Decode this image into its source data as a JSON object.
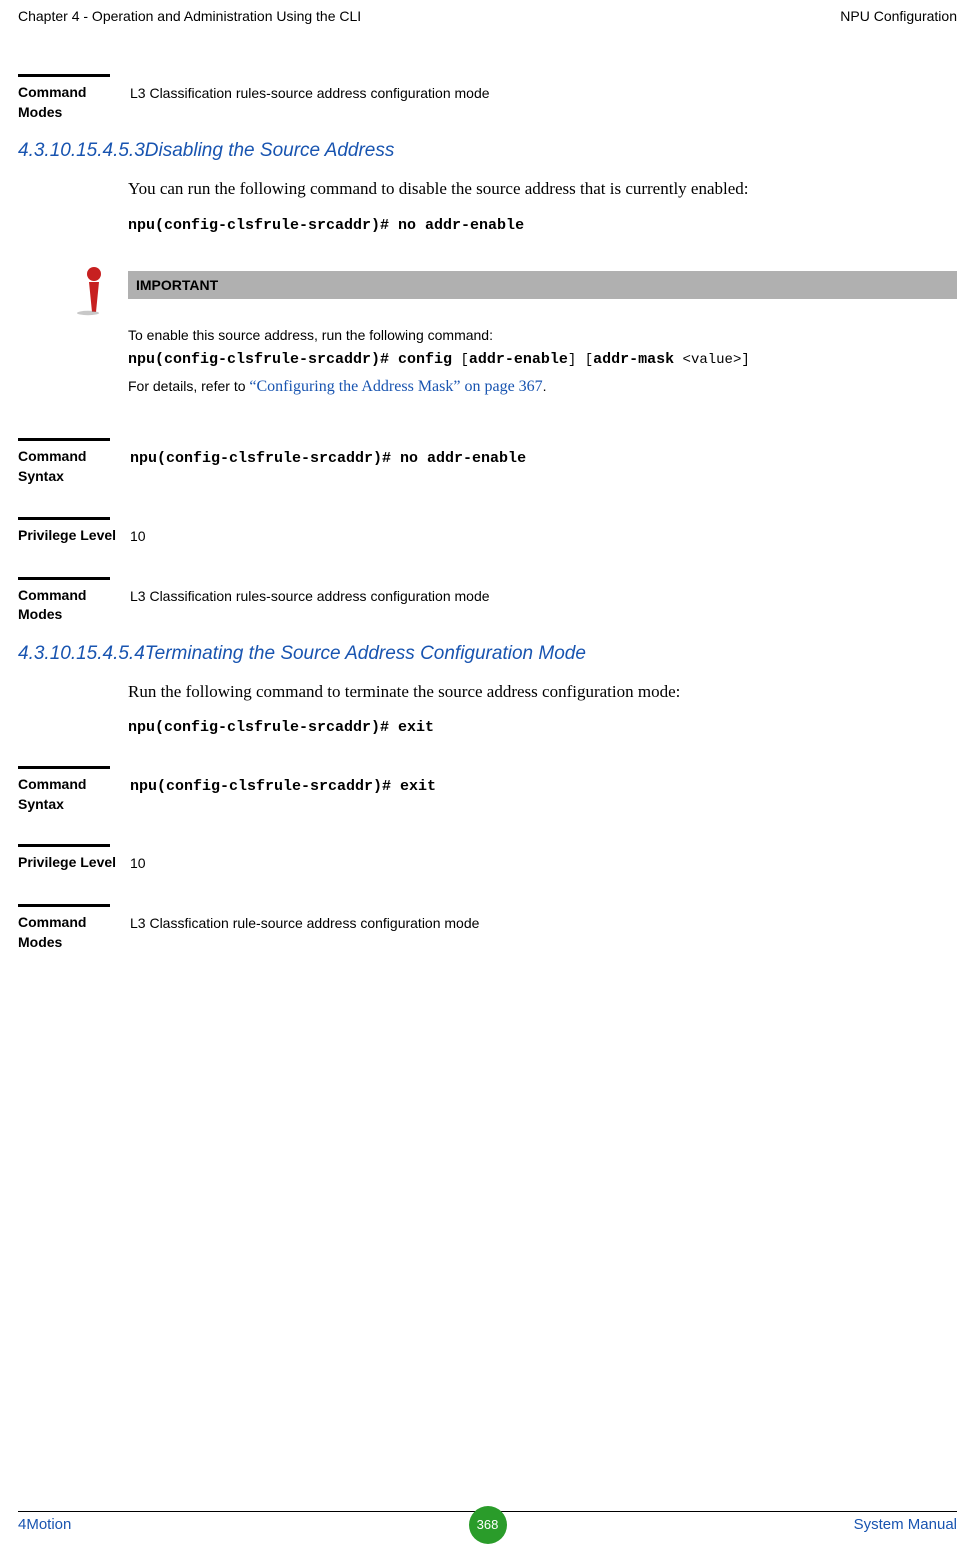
{
  "header": {
    "left": "Chapter 4 - Operation and Administration Using the CLI",
    "right": "NPU Configuration"
  },
  "block1": {
    "label": "Command Modes",
    "value": "L3 Classification rules-source address configuration mode"
  },
  "section1": {
    "heading": "4.3.10.15.4.5.3Disabling the Source Address",
    "body": "You can run the following command to disable the source address that is currently enabled:",
    "cmd": "npu(config-clsfrule-srcaddr)# no addr-enable"
  },
  "important": {
    "title": "IMPORTANT",
    "line1": "To enable this source address, run the following command:",
    "cmd_a": "npu(config-clsfrule-srcaddr)# config",
    "bracket1": " [",
    "cmd_b": "addr-enable",
    "bracket2": "] [",
    "cmd_c": "addr-mask",
    "mono_tail": " <value>]",
    "line3_a": "For details, refer to ",
    "xref": "“Configuring the Address Mask” on page 367",
    "period": "."
  },
  "block2": {
    "label_syntax": "Command Syntax",
    "value_syntax": "npu(config-clsfrule-srcaddr)# no addr-enable",
    "label_priv": "Privilege Level",
    "value_priv": "10",
    "label_modes": "Command Modes",
    "value_modes": "L3 Classification rules-source address configuration mode"
  },
  "section2": {
    "heading": "4.3.10.15.4.5.4Terminating the Source Address Configuration Mode",
    "body": "Run the following command to terminate the source address configuration mode:",
    "cmd": "npu(config-clsfrule-srcaddr)# exit"
  },
  "block3": {
    "label_syntax": "Command Syntax",
    "value_syntax": "npu(config-clsfrule-srcaddr)# exit",
    "label_priv": "Privilege Level",
    "value_priv": "10",
    "label_modes": "Command Modes",
    "value_modes": "L3 Classfication rule-source address configuration mode"
  },
  "footer": {
    "left": "4Motion",
    "page": "368",
    "right": "System Manual"
  }
}
